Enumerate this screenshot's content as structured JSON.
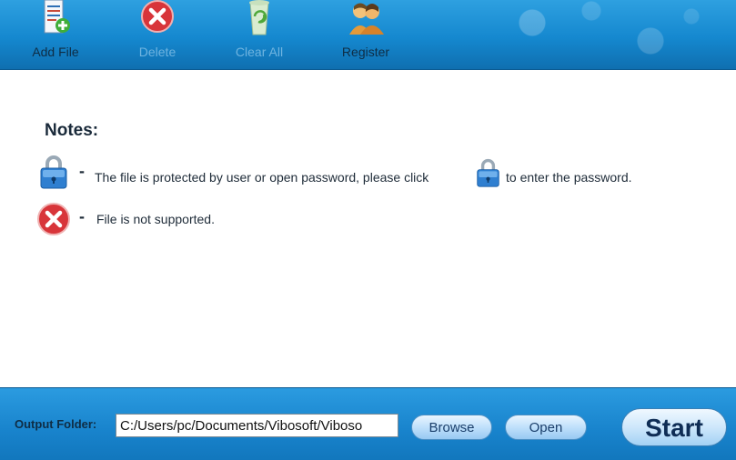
{
  "toolbar": {
    "add_file": "Add File",
    "delete": "Delete",
    "clear_all": "Clear All",
    "register": "Register"
  },
  "notes": {
    "title": "Notes:",
    "dash": "-",
    "protected_text_1": "The file is protected by user or open password,  please click",
    "protected_text_2": "to enter the password.",
    "unsupported_text": "File is not supported."
  },
  "output": {
    "label": "Output Folder:",
    "path": "C:/Users/pc/Documents/Vibosoft/Viboso"
  },
  "buttons": {
    "browse": "Browse",
    "open": "Open",
    "start": "Start"
  },
  "icons": {
    "add_file": "add-file-icon",
    "delete": "delete-icon",
    "clear_all": "clear-all-icon",
    "register": "register-icon",
    "lock": "lock-icon",
    "unsupported": "error-icon"
  }
}
